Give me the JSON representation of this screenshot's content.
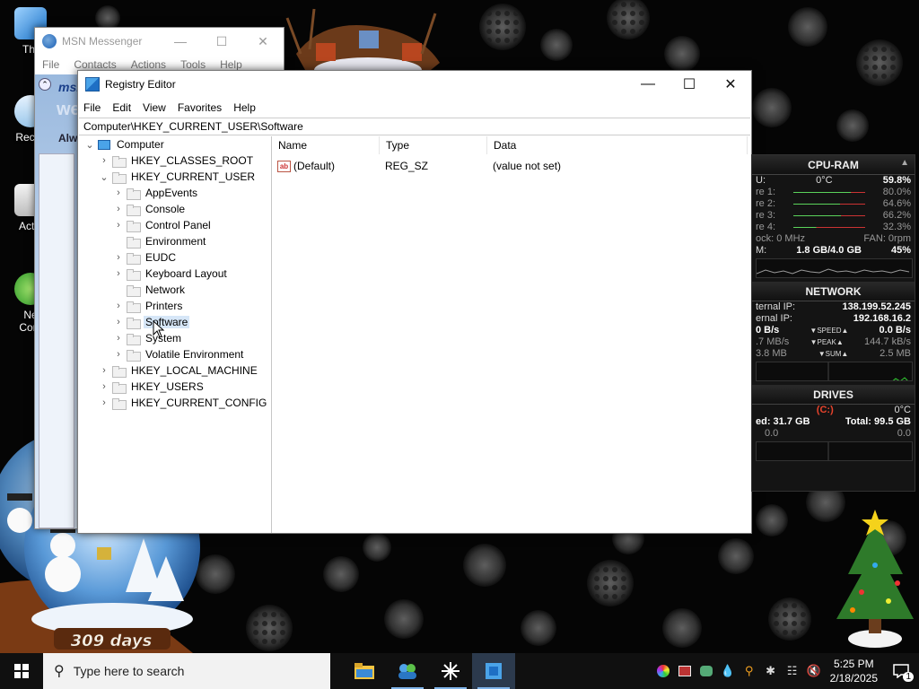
{
  "desktop": {
    "icons": [
      {
        "label": "Thr"
      },
      {
        "label": "Recyc"
      },
      {
        "label": "Activ"
      },
      {
        "label": "Ne\nCont"
      }
    ],
    "countdown": "309 days"
  },
  "msn": {
    "title": "MSN Messenger",
    "menu": [
      "File",
      "Contacts",
      "Actions",
      "Tools",
      "Help"
    ],
    "logo": "msn",
    "logo2": "we",
    "always": "Alw"
  },
  "regedit": {
    "title": "Registry Editor",
    "menu": [
      "File",
      "Edit",
      "View",
      "Favorites",
      "Help"
    ],
    "address": "Computer\\HKEY_CURRENT_USER\\Software",
    "tree": [
      {
        "label": "Computer",
        "depth": 0,
        "exp": "⌄"
      },
      {
        "label": "HKEY_CLASSES_ROOT",
        "depth": 1,
        "exp": "›"
      },
      {
        "label": "HKEY_CURRENT_USER",
        "depth": 1,
        "exp": "⌄"
      },
      {
        "label": "AppEvents",
        "depth": 2,
        "exp": "›"
      },
      {
        "label": "Console",
        "depth": 2,
        "exp": "›"
      },
      {
        "label": "Control Panel",
        "depth": 2,
        "exp": "›"
      },
      {
        "label": "Environment",
        "depth": 2,
        "exp": ""
      },
      {
        "label": "EUDC",
        "depth": 2,
        "exp": "›"
      },
      {
        "label": "Keyboard Layout",
        "depth": 2,
        "exp": "›"
      },
      {
        "label": "Network",
        "depth": 2,
        "exp": ""
      },
      {
        "label": "Printers",
        "depth": 2,
        "exp": "›"
      },
      {
        "label": "Software",
        "depth": 2,
        "exp": "›",
        "selected": true
      },
      {
        "label": "System",
        "depth": 2,
        "exp": "›"
      },
      {
        "label": "Volatile Environment",
        "depth": 2,
        "exp": "›"
      },
      {
        "label": "HKEY_LOCAL_MACHINE",
        "depth": 1,
        "exp": "›"
      },
      {
        "label": "HKEY_USERS",
        "depth": 1,
        "exp": "›"
      },
      {
        "label": "HKEY_CURRENT_CONFIG",
        "depth": 1,
        "exp": "›"
      }
    ],
    "columns": [
      "Name",
      "Type",
      "Data"
    ],
    "values": [
      {
        "name": "(Default)",
        "type": "REG_SZ",
        "data": "(value not set)"
      }
    ]
  },
  "gadget": {
    "cpu_title": "CPU-RAM",
    "cpu_label": "U:",
    "cpu_temp": "0°C",
    "cpu_pct": "59.8%",
    "cores": [
      {
        "label": "re 1:",
        "pct": "80.0%",
        "level": 0.8
      },
      {
        "label": "re 2:",
        "pct": "64.6%",
        "level": 0.646
      },
      {
        "label": "re 3:",
        "pct": "66.2%",
        "level": 0.662
      },
      {
        "label": "re 4:",
        "pct": "32.3%",
        "level": 0.323
      }
    ],
    "clock_label": "ock: 0 MHz",
    "fan": "FAN: 0rpm",
    "ram_label": "M:",
    "ram_value": "1.8 GB/4.0 GB",
    "ram_pct": "45%",
    "net_title": "NETWORK",
    "ext_ip_label": "ternal IP:",
    "ext_ip": "138.199.52.245",
    "int_ip_label": "ernal IP:",
    "int_ip": "192.168.16.2",
    "speed_left": "0 B/s",
    "speed_label": "SPEED",
    "speed_right": "0.0 B/s",
    "peak_left": ".7 MB/s",
    "peak_label": "PEAK",
    "peak_right": "144.7 kB/s",
    "sum_left": "3.8 MB",
    "sum_label": "SUM",
    "sum_right": "2.5 MB",
    "drives_title": "DRIVES",
    "drive_name": "(C:)",
    "drive_temp": "0°C",
    "drive_used": "ed: 31.7 GB",
    "drive_total": "Total: 99.5 GB",
    "drive_left": "0.0",
    "drive_right": "0.0"
  },
  "taskbar": {
    "search_placeholder": "Type here to search",
    "time": "5:25 PM",
    "date": "2/18/2025",
    "notif_count": "1"
  }
}
